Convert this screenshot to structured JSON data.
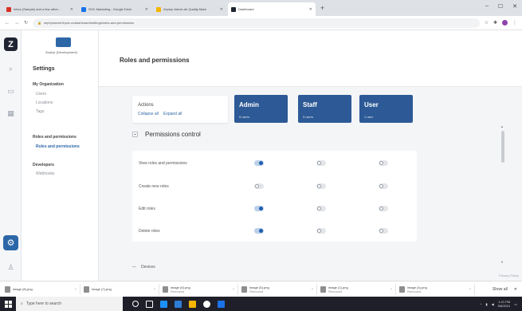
{
  "browser": {
    "tabs": [
      {
        "title": "Inbox (Sample) and a few other...",
        "color": "#d93025",
        "active": false
      },
      {
        "title": "SOC Marketing - Google Drive",
        "color": "#1a73e8",
        "active": false
      },
      {
        "title": "Zephyr Admin de Quality Mark",
        "color": "#f4b400",
        "active": false
      },
      {
        "title": "Dashboard",
        "color": "#1f2433",
        "active": true
      }
    ],
    "url": "zephyrsmart.thyxk.co/dashboard/settings/roles-and-permissions",
    "new_tab": "+",
    "controls": [
      "–",
      "☐",
      "✕"
    ]
  },
  "rail": {
    "logo": "Z",
    "icons": [
      "search-icon",
      "inbox-icon",
      "grid-icon"
    ],
    "gear": "⚙",
    "user": "♙"
  },
  "sidebar": {
    "org_name": "Zephyr (Development)",
    "title": "Settings",
    "sections": [
      {
        "label": "My Organization",
        "items": [
          "Users",
          "Locations",
          "Tags"
        ]
      },
      {
        "label": "Roles and permissions",
        "items": [
          "Roles and permissions"
        ]
      },
      {
        "label": "Developers",
        "items": [
          "Webhooks"
        ]
      }
    ]
  },
  "page": {
    "title": "Roles and permissions",
    "actions": {
      "title": "Actions",
      "collapse": "Collapse all",
      "expand": "Expand all"
    },
    "roles": [
      {
        "name": "Admin",
        "users": "5 users"
      },
      {
        "name": "Staff",
        "users": "3 users"
      },
      {
        "name": "User",
        "users": "1 user"
      }
    ],
    "section": "Permissions control",
    "permissions": [
      {
        "label": "View roles and permissions",
        "admin": true,
        "staff": false,
        "user": false
      },
      {
        "label": "Create new roles",
        "admin": false,
        "staff": false,
        "user": false
      },
      {
        "label": "Edit roles",
        "admin": true,
        "staff": false,
        "user": false
      },
      {
        "label": "Delete roles",
        "admin": true,
        "staff": false,
        "user": false
      }
    ],
    "next_section": "Devices",
    "privacy": "Privacy Policy",
    "accent_color": "#2d5a96"
  },
  "downloads": {
    "items": [
      {
        "name": "image (8).png",
        "status": ""
      },
      {
        "name": "image (7).png",
        "status": ""
      },
      {
        "name": "image (6).png",
        "status": "Removed"
      },
      {
        "name": "image (5).png",
        "status": "Removed"
      },
      {
        "name": "image (1).png",
        "status": "Removed"
      },
      {
        "name": "image (4).png",
        "status": "Removed"
      }
    ],
    "show_all": "Show all",
    "close": "✕"
  },
  "taskbar": {
    "search_placeholder": "Type here to search",
    "time": "1:21 PM",
    "date": "5/6/2021",
    "app_colors": [
      "#ffffff",
      "#ffffff",
      "#1e90ff",
      "#2e7dd7",
      "#f4b400",
      "#ffffff",
      "#1a73e8"
    ]
  }
}
